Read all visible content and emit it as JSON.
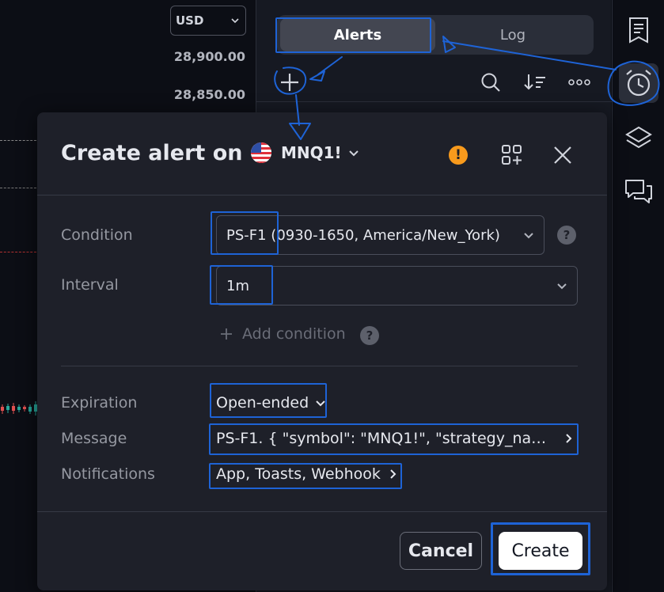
{
  "chart": {
    "currency": "USD",
    "price_labels": [
      "28,900.00",
      "28,850.00"
    ]
  },
  "alerts_panel": {
    "tabs": [
      {
        "label": "Alerts",
        "active": true
      },
      {
        "label": "Log",
        "active": false
      }
    ],
    "toolbar_icons": [
      "plus-icon",
      "search-icon",
      "sort-icon",
      "more-icon"
    ]
  },
  "sidebar": {
    "icons": [
      "watchlist-icon",
      "alarm-clock-icon",
      "layers-icon",
      "chat-icon"
    ],
    "active": "alarm-clock-icon"
  },
  "dialog": {
    "title": "Create alert on",
    "symbol": "MNQ1!",
    "condition": {
      "label": "Condition",
      "value": "PS-F1 (0930-1650, America/New_York)"
    },
    "interval": {
      "label": "Interval",
      "value": "1m"
    },
    "add_condition_label": "Add condition",
    "expiration": {
      "label": "Expiration",
      "value": "Open-ended"
    },
    "message": {
      "label": "Message",
      "value": "PS-F1. { \"symbol\": \"MNQ1!\", \"strategy_name..."
    },
    "notifications": {
      "label": "Notifications",
      "value": "App, Toasts, Webhook"
    },
    "cancel_label": "Cancel",
    "create_label": "Create"
  },
  "colors": {
    "warning": "#f89a1c",
    "annotation": "#1e63d6",
    "panel_bg": "#161922",
    "dialog_bg": "#1e2029"
  }
}
